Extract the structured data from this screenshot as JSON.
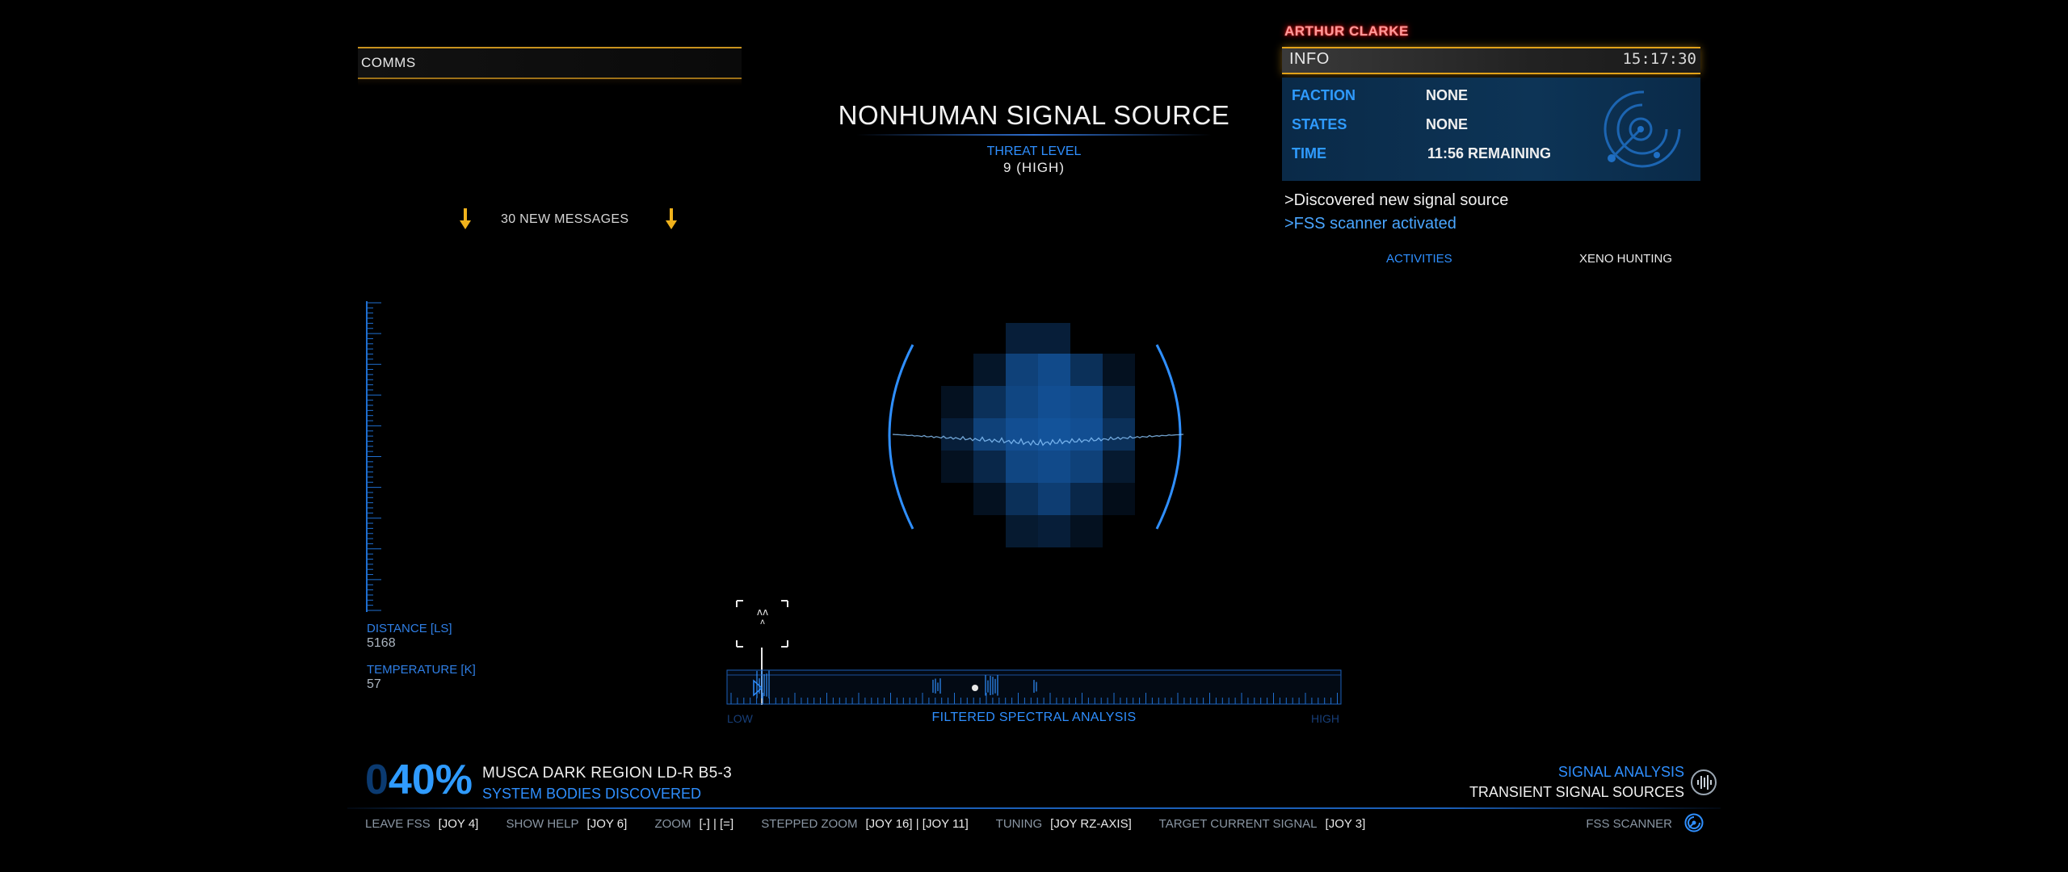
{
  "comms": {
    "title": "COMMS",
    "new_messages": "30 NEW MESSAGES"
  },
  "signal": {
    "title": "NONHUMAN SIGNAL SOURCE",
    "threat_label": "THREAT LEVEL",
    "threat_value": "9 (HIGH)"
  },
  "info": {
    "owner": "ARTHUR CLARKE",
    "title": "INFO",
    "time": "15:17:30",
    "rows": [
      {
        "key": "FACTION",
        "value": "NONE"
      },
      {
        "key": "STATES",
        "value": "NONE"
      },
      {
        "key": "TIME",
        "value": "11:56 REMAINING"
      }
    ],
    "log": [
      ">Discovered new signal source",
      ">FSS scanner activated"
    ],
    "activities_label": "ACTIVITIES",
    "activities_value": "XENO HUNTING",
    "icon": "radar-icon"
  },
  "readouts": {
    "distance_label": "DISTANCE [LS]",
    "distance_value": "5168",
    "temperature_label": "TEMPERATURE [K]",
    "temperature_value": "57"
  },
  "spectrum": {
    "title": "FILTERED SPECTRAL ANALYSIS",
    "low": "LOW",
    "high": "HIGH"
  },
  "system": {
    "percent_lead": "0",
    "percent_value": "40%",
    "name": "MUSCA DARK REGION LD-R B5-3",
    "subtitle": "SYSTEM BODIES DISCOVERED"
  },
  "analysis": {
    "label": "SIGNAL ANALYSIS",
    "type": "TRANSIENT SIGNAL SOURCES",
    "icon": "waveform-icon"
  },
  "hints": [
    {
      "label": "LEAVE FSS",
      "key": "[JOY 4]"
    },
    {
      "label": "SHOW HELP",
      "key": "[JOY 6]"
    },
    {
      "label": "ZOOM",
      "key": "[-] | [=]"
    },
    {
      "label": "STEPPED ZOOM",
      "key": "[JOY 16] | [JOY 11]"
    },
    {
      "label": "TUNING",
      "key": "[JOY RZ-AXIS]"
    },
    {
      "label": "TARGET CURRENT SIGNAL",
      "key": "[JOY 3]"
    }
  ],
  "fss": {
    "label": "FSS SCANNER",
    "icon": "fss-scanner-icon"
  },
  "colors": {
    "accent_blue": "#2f8fff",
    "accent_orange": "#e2a21a",
    "owner_red": "#ff2020"
  }
}
